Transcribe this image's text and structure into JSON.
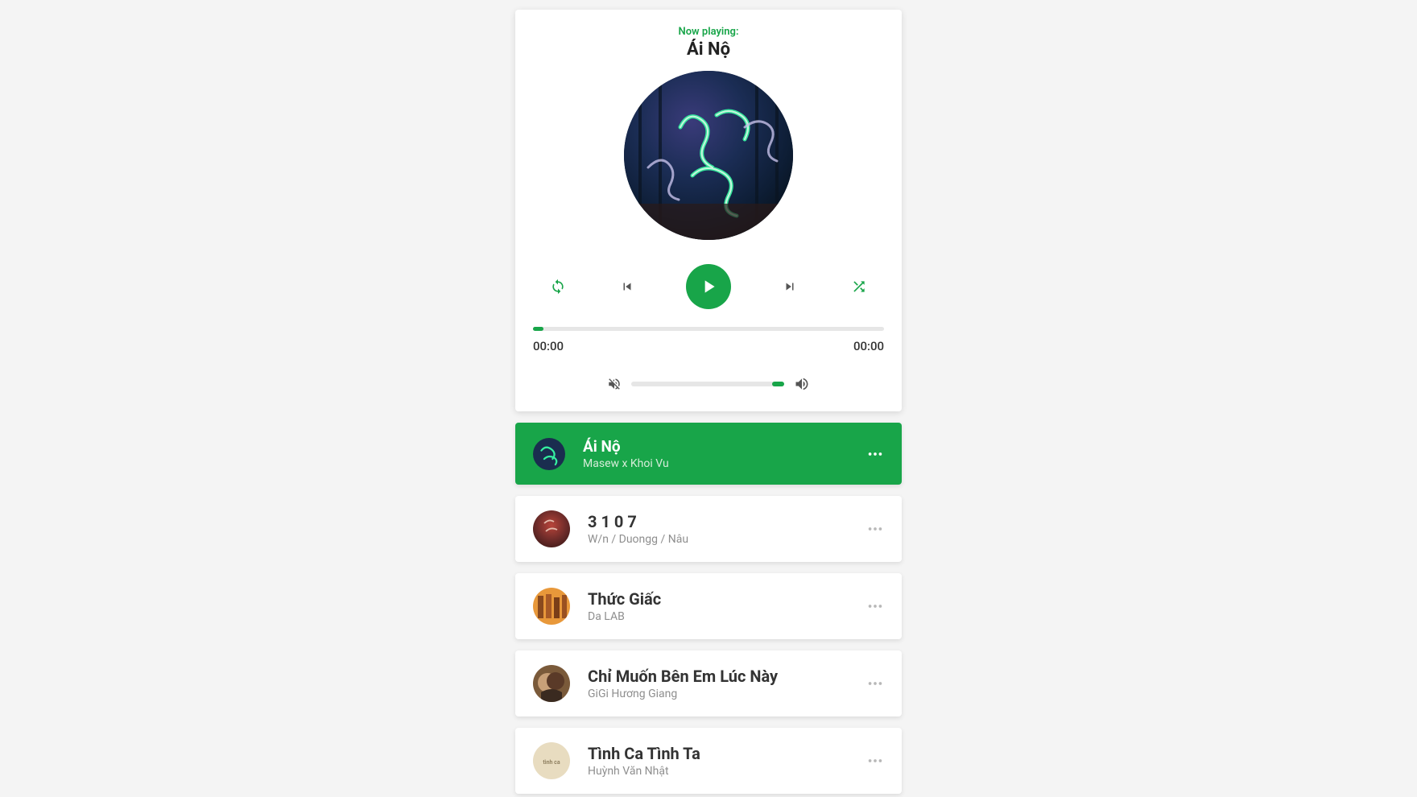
{
  "player": {
    "now_playing_label": "Now playing:",
    "current_title": "Ái Nộ",
    "time_current": "00:00",
    "time_total": "00:00"
  },
  "colors": {
    "accent": "#18a549"
  },
  "playlist": [
    {
      "title": "Ái Nộ",
      "artist": "Masew x Khoi Vu",
      "active": true
    },
    {
      "title": "3 1 0 7",
      "artist": "W/n / Duongg / Nâu",
      "active": false
    },
    {
      "title": "Thức Giấc",
      "artist": "Da LAB",
      "active": false
    },
    {
      "title": "Chỉ Muốn Bên Em Lúc Này",
      "artist": "GiGi Hương Giang",
      "active": false
    },
    {
      "title": "Tình Ca Tình Ta",
      "artist": "Huỳnh Văn Nhật",
      "active": false
    }
  ]
}
